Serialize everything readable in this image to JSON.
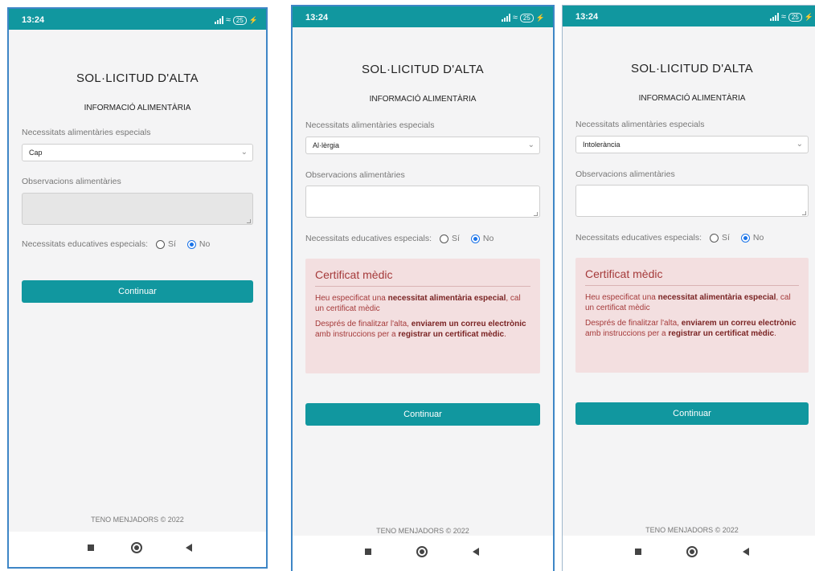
{
  "status_bar": {
    "time": "13:24",
    "battery": "25"
  },
  "form": {
    "title": "SOL·LICITUD D'ALTA",
    "subtitle": "INFORMACIÓ ALIMENTÀRIA",
    "diet_label": "Necessitats alimentàries especials",
    "observations_label": "Observacions alimentàries",
    "educational_label": "Necessitats educatives especials:",
    "radio_yes": "Sí",
    "radio_no": "No",
    "continue_label": "Continuar"
  },
  "screens": [
    {
      "selected_diet": "Cap",
      "observations_disabled": true,
      "educational_value": "No",
      "show_certificate_alert": false
    },
    {
      "selected_diet": "Al·lèrgia",
      "observations_disabled": false,
      "educational_value": "No",
      "show_certificate_alert": true
    },
    {
      "selected_diet": "Intolerància",
      "observations_disabled": false,
      "educational_value": "No",
      "show_certificate_alert": true
    }
  ],
  "alert": {
    "title": "Certificat mèdic",
    "p1_a": "Heu especificat una ",
    "p1_b": "necessitat alimentària especial",
    "p1_c": ", cal un certificat mèdic",
    "p2_a": "Després de finalitzar l'alta, ",
    "p2_b": "enviarem un correu electrònic",
    "p2_c": " amb instruccions per a ",
    "p2_d": "registrar un certificat mèdic",
    "p2_e": "."
  },
  "footer": "TENO MENJADORS © 2022",
  "colors": {
    "accent": "#11979f",
    "alert_bg": "#f3dfe0",
    "alert_text": "#a53a3a"
  }
}
